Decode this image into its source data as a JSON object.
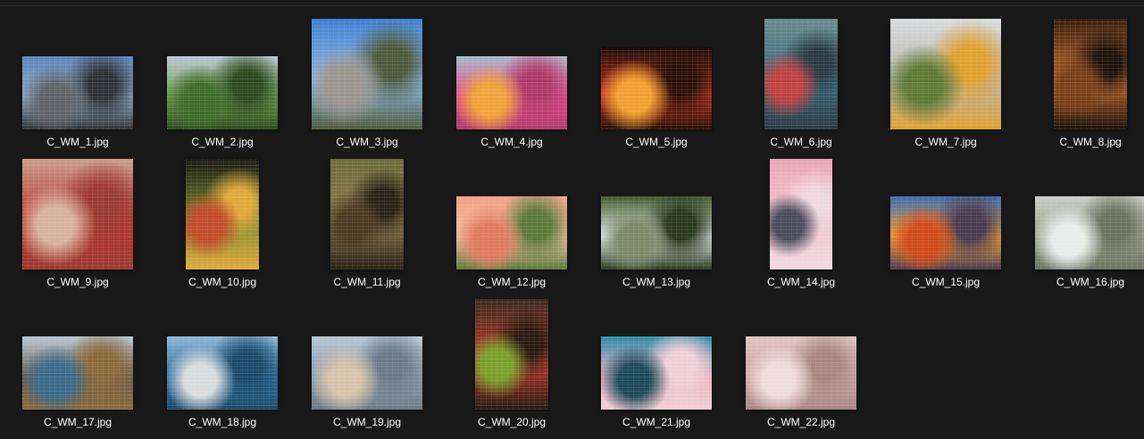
{
  "files": [
    {
      "name": "C_WM_1.jpg",
      "thumb_icon": "city-waterfront-image-icon",
      "palette": [
        "#5a84b8",
        "#8fa8c6",
        "#5f6468",
        "#2f3338"
      ]
    },
    {
      "name": "C_WM_2.jpg",
      "thumb_icon": "green-hills-image-icon",
      "palette": [
        "#b8c6d2",
        "#6e9a4c",
        "#3e6b28",
        "#2c4a1e"
      ]
    },
    {
      "name": "C_WM_3.jpg",
      "thumb_icon": "lighthouse-image-icon",
      "palette": [
        "#3d7fd0",
        "#8db8e6",
        "#9a9690",
        "#4d5a3c"
      ]
    },
    {
      "name": "C_WM_4.jpg",
      "thumb_icon": "flower-parade-image-icon",
      "palette": [
        "#a6b9c8",
        "#e04a8c",
        "#f0a23a",
        "#b03a6a"
      ]
    },
    {
      "name": "C_WM_5.jpg",
      "thumb_icon": "sunset-image-icon",
      "palette": [
        "#1a0c08",
        "#c2301a",
        "#f2a030",
        "#2a1006"
      ]
    },
    {
      "name": "C_WM_6.jpg",
      "thumb_icon": "balloons-child-image-icon",
      "palette": [
        "#6a8a8e",
        "#3a6a7a",
        "#c04040",
        "#2a3a44"
      ]
    },
    {
      "name": "C_WM_7.jpg",
      "thumb_icon": "fruit-table-image-icon",
      "palette": [
        "#d8dadc",
        "#b6b2aa",
        "#5e7a34",
        "#e0a030"
      ]
    },
    {
      "name": "C_WM_8.jpg",
      "thumb_icon": "portrait-orange-image-icon",
      "palette": [
        "#3a1f10",
        "#c26a2a",
        "#7a4018",
        "#1e120a"
      ]
    },
    {
      "name": "C_WM_9.jpg",
      "thumb_icon": "clown-face-image-icon",
      "palette": [
        "#c89e88",
        "#b83232",
        "#d8b29a",
        "#9a3a30"
      ]
    },
    {
      "name": "C_WM_10.jpg",
      "thumb_icon": "fruit-basket-image-icon",
      "palette": [
        "#1a1a14",
        "#7a8a2a",
        "#c24a2a",
        "#e0a83a"
      ]
    },
    {
      "name": "C_WM_11.jpg",
      "thumb_icon": "mona-lisa-image-icon",
      "palette": [
        "#6e6a3a",
        "#8a7a4a",
        "#4a3a20",
        "#2a2016"
      ]
    },
    {
      "name": "C_WM_12.jpg",
      "thumb_icon": "dahlias-image-icon",
      "palette": [
        "#f0a080",
        "#f2c0a0",
        "#e07a60",
        "#5a7a3a"
      ]
    },
    {
      "name": "C_WM_13.jpg",
      "thumb_icon": "white-blossom-image-icon",
      "palette": [
        "#3e5a2a",
        "#e6e8ea",
        "#7a8a6a",
        "#2a3a20"
      ]
    },
    {
      "name": "C_WM_14.jpg",
      "thumb_icon": "penguin-toy-image-icon",
      "palette": [
        "#e8a6b6",
        "#f2c6d0",
        "#4a4a5a",
        "#f0d8e0"
      ]
    },
    {
      "name": "C_WM_15.jpg",
      "thumb_icon": "sunrise-clouds-image-icon",
      "palette": [
        "#3a6ab0",
        "#f0a030",
        "#d04a1a",
        "#4a3a50"
      ]
    },
    {
      "name": "C_WM_16.jpg",
      "thumb_icon": "white-flowers-image-icon",
      "palette": [
        "#c8ccc4",
        "#9aa08a",
        "#e8ecea",
        "#6a7260"
      ]
    },
    {
      "name": "C_WM_17.jpg",
      "thumb_icon": "tall-ship-image-icon",
      "palette": [
        "#b8c8d6",
        "#6a5a4a",
        "#3a6a8a",
        "#8a6a3a"
      ]
    },
    {
      "name": "C_WM_18.jpg",
      "thumb_icon": "opera-house-image-icon",
      "palette": [
        "#8ab6d6",
        "#2a6a9a",
        "#d8dcde",
        "#1a4a6a"
      ]
    },
    {
      "name": "C_WM_19.jpg",
      "thumb_icon": "beach-city-image-icon",
      "palette": [
        "#b8c6d4",
        "#8a9aaa",
        "#d6c2a8",
        "#6a7a88"
      ]
    },
    {
      "name": "C_WM_20.jpg",
      "thumb_icon": "flower-wreath-image-icon",
      "palette": [
        "#3a2a1e",
        "#c03a2a",
        "#7aa02a",
        "#2a1a10"
      ]
    },
    {
      "name": "C_WM_21.jpg",
      "thumb_icon": "pink-blossom-image-icon",
      "palette": [
        "#2a8aa8",
        "#e8b0c0",
        "#1e4a5a",
        "#f0d0d8"
      ]
    },
    {
      "name": "C_WM_22.jpg",
      "thumb_icon": "cherry-blossom-image-icon",
      "palette": [
        "#e0c4c0",
        "#c8a6a4",
        "#f0dcd8",
        "#a88682"
      ]
    }
  ]
}
